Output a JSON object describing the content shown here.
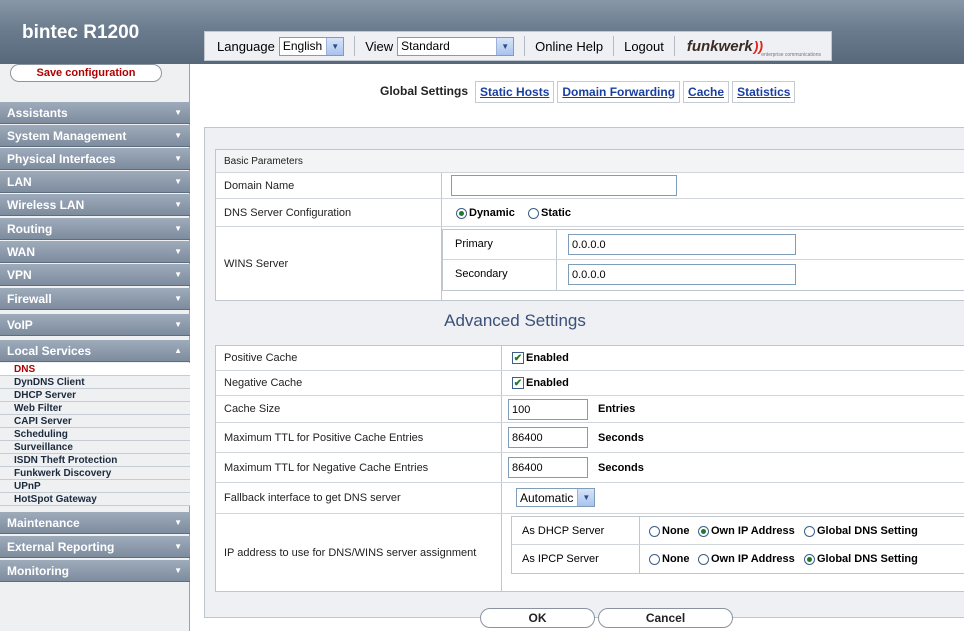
{
  "header": {
    "brand": "bintec R1200",
    "language_label": "Language",
    "language_value": "English",
    "view_label": "View",
    "view_value": "Standard",
    "online_help": "Online Help",
    "logout": "Logout",
    "logo_text": "funkwerk",
    "logo_tagline": "enterprise communications"
  },
  "sidebar": {
    "save_label": "Save configuration",
    "menus": [
      "Assistants",
      "System Management",
      "Physical Interfaces",
      "LAN",
      "Wireless LAN",
      "Routing",
      "WAN",
      "VPN",
      "Firewall",
      "VoIP",
      "Local Services",
      "Maintenance",
      "External Reporting",
      "Monitoring"
    ],
    "local_services_items": [
      "DNS",
      "DynDNS Client",
      "DHCP Server",
      "Web Filter",
      "CAPI Server",
      "Scheduling",
      "Surveillance",
      "ISDN Theft Protection",
      "Funkwerk Discovery",
      "UPnP",
      "HotSpot Gateway"
    ]
  },
  "tabs": {
    "current": "Global Settings",
    "links": [
      "Static Hosts",
      "Domain Forwarding",
      "Cache",
      "Statistics"
    ]
  },
  "basic": {
    "section_title": "Basic Parameters",
    "domain_name_label": "Domain Name",
    "domain_name_value": "",
    "dns_config_label": "DNS Server Configuration",
    "dns_dynamic": "Dynamic",
    "dns_static": "Static",
    "wins_label": "WINS Server",
    "primary_label": "Primary",
    "primary_value": "0.0.0.0",
    "secondary_label": "Secondary",
    "secondary_value": "0.0.0.0"
  },
  "advanced": {
    "title": "Advanced Settings",
    "positive_cache_label": "Positive Cache",
    "negative_cache_label": "Negative Cache",
    "enabled_text": "Enabled",
    "cache_size_label": "Cache Size",
    "cache_size_value": "100",
    "entries_unit": "Entries",
    "max_ttl_pos_label": "Maximum TTL for Positive Cache Entries",
    "max_ttl_pos_value": "86400",
    "max_ttl_neg_label": "Maximum TTL for Negative Cache Entries",
    "max_ttl_neg_value": "86400",
    "seconds_unit": "Seconds",
    "fallback_label": "Fallback interface to get DNS server",
    "fallback_value": "Automatic",
    "ip_assign_label": "IP address to use for DNS/WINS server assignment",
    "as_dhcp_label": "As DHCP Server",
    "as_ipcp_label": "As IPCP Server",
    "opt_none": "None",
    "opt_own_ip": "Own IP Address",
    "opt_global": "Global DNS Setting"
  },
  "buttons": {
    "ok": "OK",
    "cancel": "Cancel"
  }
}
